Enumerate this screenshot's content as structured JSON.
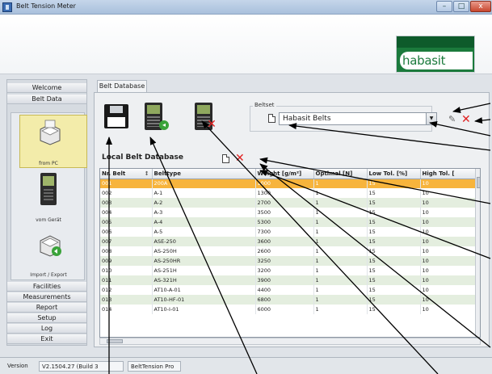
{
  "window": {
    "title": "Belt Tension Meter"
  },
  "brand": {
    "logo_text": "habasit"
  },
  "nav": {
    "top_items": [
      {
        "label": "Welcome"
      },
      {
        "label": "Belt Data"
      }
    ],
    "tools": [
      {
        "label": "from PC"
      },
      {
        "label": "vom Gerät"
      },
      {
        "label": "Import / Export"
      }
    ],
    "bottom_items": [
      {
        "label": "Facilities"
      },
      {
        "label": "Measurements"
      },
      {
        "label": "Report"
      },
      {
        "label": "Setup"
      },
      {
        "label": "Log"
      },
      {
        "label": "Exit"
      }
    ]
  },
  "main": {
    "tab_label": "Belt Database",
    "beltset": {
      "title": "Beltset",
      "selected": "Habasit Belts"
    },
    "local_db_title": "Local Belt Database",
    "table": {
      "columns": [
        "Nr. Belt",
        "Belttype",
        "Weight [g/m²]",
        "Optimal [N]",
        "Low Tol. [%]",
        "High Tol. ["
      ],
      "rows": [
        [
          "001",
          "200A",
          "1000",
          "1",
          "15",
          "10"
        ],
        [
          "002",
          "A-1",
          "1300",
          "1",
          "15",
          "10"
        ],
        [
          "003",
          "A-2",
          "2700",
          "1",
          "15",
          "10"
        ],
        [
          "004",
          "A-3",
          "3500",
          "1",
          "15",
          "10"
        ],
        [
          "005",
          "A-4",
          "5300",
          "1",
          "15",
          "10"
        ],
        [
          "006",
          "A-5",
          "7300",
          "1",
          "15",
          "10"
        ],
        [
          "007",
          "ASE-250",
          "3600",
          "1",
          "15",
          "10"
        ],
        [
          "008",
          "AS-250H",
          "2600",
          "1",
          "15",
          "10"
        ],
        [
          "009",
          "AS-250HR",
          "3250",
          "1",
          "15",
          "10"
        ],
        [
          "010",
          "AS-251H",
          "3200",
          "1",
          "15",
          "10"
        ],
        [
          "011",
          "AS-321H",
          "3900",
          "1",
          "15",
          "10"
        ],
        [
          "012",
          "AT10-A-01",
          "4400",
          "1",
          "15",
          "10"
        ],
        [
          "013",
          "AT10-HF-01",
          "6800",
          "1",
          "15",
          "10"
        ],
        [
          "014",
          "AT10-I-01",
          "6000",
          "1",
          "15",
          "10"
        ]
      ]
    }
  },
  "status": {
    "version_label": "Version",
    "version_value": "V2.1504.27  (Build 3",
    "app_name": "BeltTension Pro"
  },
  "colors": {
    "selected_row": "#f7b43c",
    "alt_row": "#e4eedf",
    "accent_green": "#1b7a3c",
    "delete_red": "#e02020"
  },
  "icons": [
    "save-icon",
    "meter-download-icon",
    "meter-delete-icon",
    "new-document-icon",
    "delete-icon",
    "wrench-icon",
    "sort-arrow-icon"
  ]
}
